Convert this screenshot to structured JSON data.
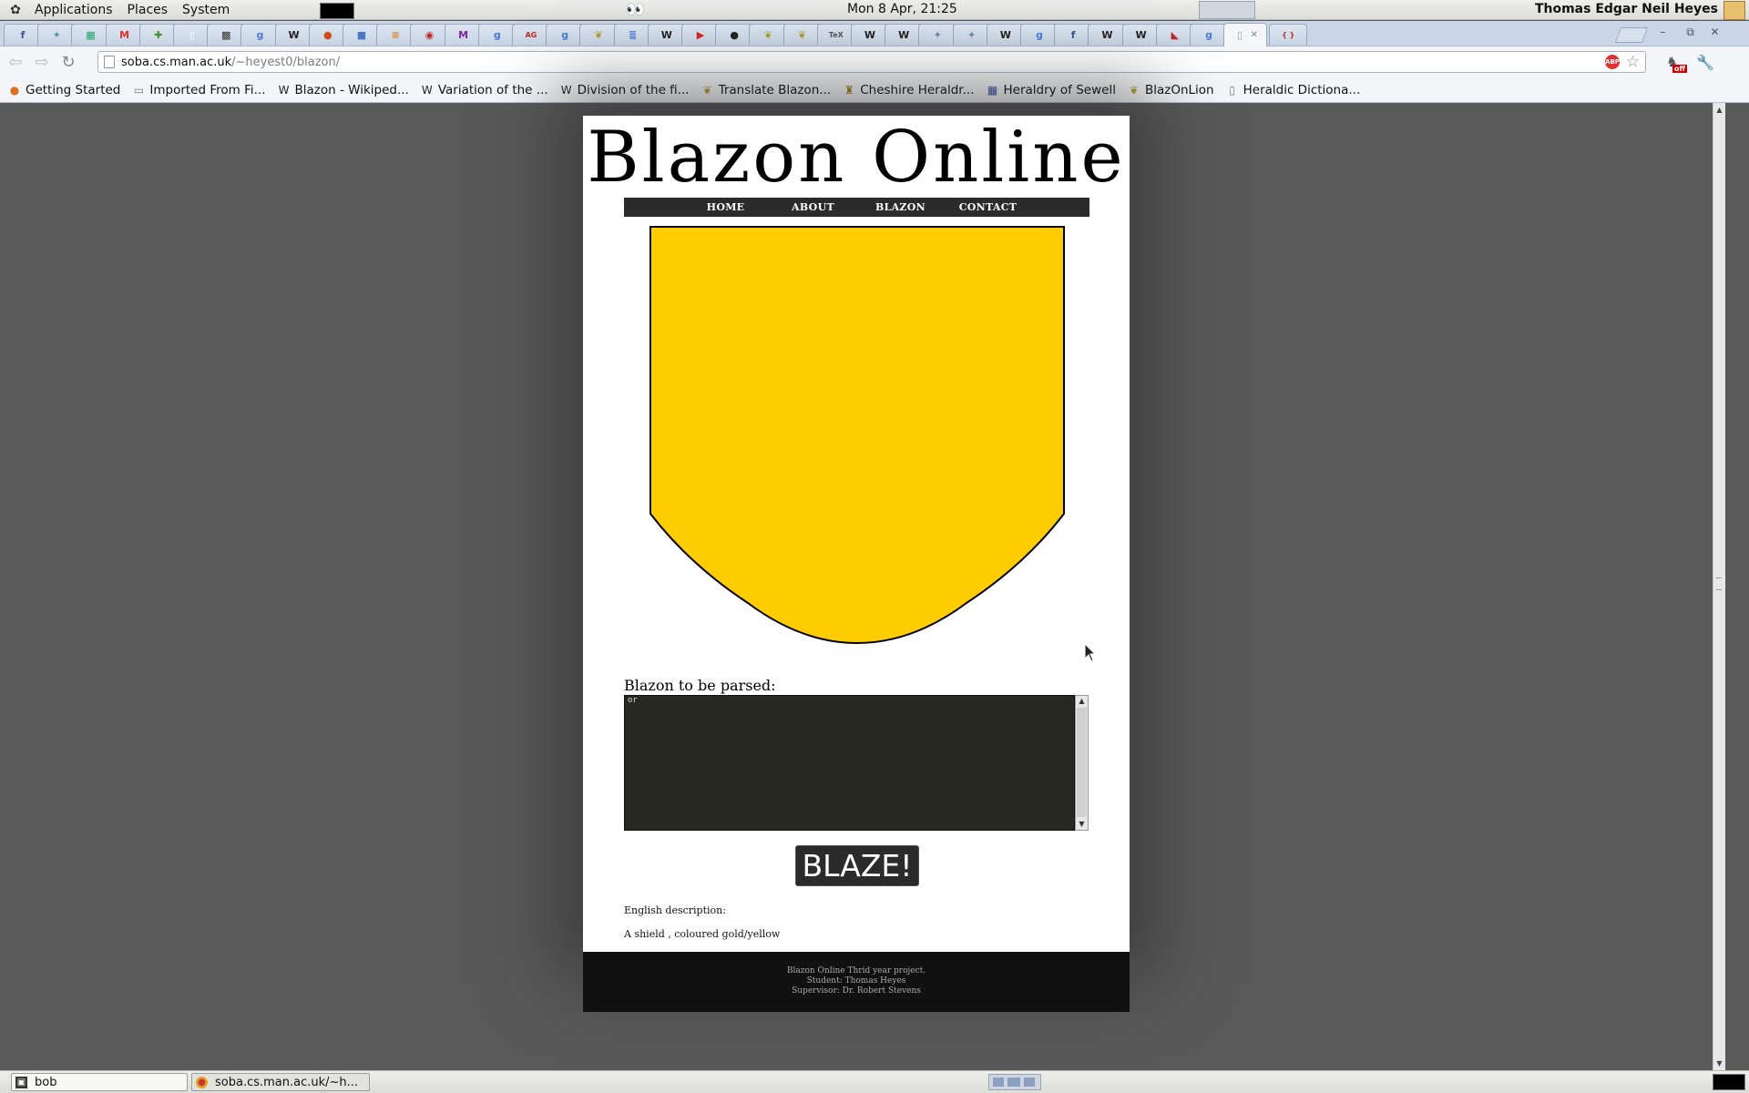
{
  "top_panel": {
    "menus": [
      "Applications",
      "Places",
      "System"
    ],
    "clock": "Mon  8 Apr, 21:25",
    "user": "Thomas Edgar Neil Heyes",
    "eyes": "👀"
  },
  "tabs": [
    {
      "icon": "facebook-icon",
      "glyph": "f",
      "color": "#3b5998"
    },
    {
      "icon": "blazon-icon",
      "glyph": "✦",
      "color": "#5a8fb0"
    },
    {
      "icon": "spreadsheet-icon",
      "glyph": "▦",
      "color": "#1fa463"
    },
    {
      "icon": "gmail-icon",
      "glyph": "M",
      "color": "#d33"
    },
    {
      "icon": "google-icon",
      "glyph": "✚",
      "color": "#4b8f29"
    },
    {
      "icon": "document-icon",
      "glyph": "▯",
      "color": "#ffffff"
    },
    {
      "icon": "qr-icon",
      "glyph": "▩",
      "color": "#333333"
    },
    {
      "icon": "google-icon",
      "glyph": "g",
      "color": "#4a7bd8"
    },
    {
      "icon": "wikipedia-icon",
      "glyph": "W",
      "color": "#222222"
    },
    {
      "icon": "orange-app-icon",
      "glyph": "●",
      "color": "#d04a1a"
    },
    {
      "icon": "blue-square-icon",
      "glyph": "■",
      "color": "#4a78c4"
    },
    {
      "icon": "stack-icon",
      "glyph": "≡",
      "color": "#e07b20"
    },
    {
      "icon": "red-circle-icon",
      "glyph": "◉",
      "color": "#c02828"
    },
    {
      "icon": "m-icon",
      "glyph": "M",
      "color": "#7a2a9a"
    },
    {
      "icon": "google-icon",
      "glyph": "g",
      "color": "#4a7bd8"
    },
    {
      "icon": "ag-icon",
      "glyph": "AG",
      "color": "#c02828"
    },
    {
      "icon": "google-icon",
      "glyph": "g",
      "color": "#4a7bd8"
    },
    {
      "icon": "lion-icon",
      "glyph": "❦",
      "color": "#b09a30"
    },
    {
      "icon": "docs-icon",
      "glyph": "≣",
      "color": "#3d6fd8"
    },
    {
      "icon": "wikipedia-icon",
      "glyph": "W",
      "color": "#222222"
    },
    {
      "icon": "youtube-icon",
      "glyph": "▶",
      "color": "#d22"
    },
    {
      "icon": "github-icon",
      "glyph": "●",
      "color": "#222222"
    },
    {
      "icon": "lion-icon",
      "glyph": "❦",
      "color": "#b09a30"
    },
    {
      "icon": "lion-icon",
      "glyph": "❦",
      "color": "#b09a30"
    },
    {
      "icon": "tex-icon",
      "glyph": "TeX",
      "color": "#555555"
    },
    {
      "icon": "wikipedia-icon",
      "glyph": "W",
      "color": "#222222"
    },
    {
      "icon": "wikipedia-icon",
      "glyph": "W",
      "color": "#222222"
    },
    {
      "icon": "blazon-icon",
      "glyph": "✦",
      "color": "#5a8fb0"
    },
    {
      "icon": "blazon-icon",
      "glyph": "✦",
      "color": "#5a8fb0"
    },
    {
      "icon": "wikipedia-icon",
      "glyph": "W",
      "color": "#222222"
    },
    {
      "icon": "google-icon",
      "glyph": "g",
      "color": "#4a7bd8"
    },
    {
      "icon": "facebook-icon",
      "glyph": "f",
      "color": "#3b5998"
    },
    {
      "icon": "wikipedia-icon",
      "glyph": "W",
      "color": "#222222"
    },
    {
      "icon": "wikipedia-icon",
      "glyph": "W",
      "color": "#222222"
    },
    {
      "icon": "flag-icon",
      "glyph": "◣",
      "color": "#c02828"
    },
    {
      "icon": "google-icon",
      "glyph": "g",
      "color": "#4a7bd8"
    },
    {
      "icon": "page-icon",
      "glyph": "▯",
      "color": "#999999",
      "active": true
    },
    {
      "icon": "bracket-icon",
      "glyph": "{ }",
      "color": "#c02828"
    }
  ],
  "omnibox": {
    "host": "soba.cs.man.ac.uk",
    "path": "/~heyest0/blazon/",
    "abp": "ABP",
    "ext_off": "off"
  },
  "bookmarks": [
    {
      "label": "Getting Started",
      "icon": "firefox-icon",
      "glyph": "●",
      "color": "#d9701f"
    },
    {
      "label": "Imported From Fi...",
      "icon": "folder-icon",
      "glyph": "▭",
      "color": "#777777"
    },
    {
      "label": "Blazon - Wikiped...",
      "icon": "wikipedia-icon",
      "glyph": "W",
      "color": "#222222"
    },
    {
      "label": "Variation of the ...",
      "icon": "wikipedia-icon",
      "glyph": "W",
      "color": "#222222"
    },
    {
      "label": "Division of the fi...",
      "icon": "wikipedia-icon",
      "glyph": "W",
      "color": "#222222"
    },
    {
      "label": "Translate Blazon...",
      "icon": "lion-icon",
      "glyph": "❦",
      "color": "#b09a30"
    },
    {
      "label": "Cheshire Heraldr...",
      "icon": "heraldry-icon",
      "glyph": "♜",
      "color": "#a07a20"
    },
    {
      "label": "Heraldry of Sewell",
      "icon": "calendar-icon",
      "glyph": "▦",
      "color": "#3050a0"
    },
    {
      "label": "BlazOnLion",
      "icon": "lion-icon",
      "glyph": "❦",
      "color": "#b09a30"
    },
    {
      "label": "Heraldic Dictiona...",
      "icon": "page-icon",
      "glyph": "▯",
      "color": "#777777"
    }
  ],
  "site": {
    "title": "Blazon Online",
    "nav": [
      "HOME",
      "ABOUT",
      "BLAZON",
      "CONTACT"
    ],
    "shield_tincture": "#ffcc00",
    "blazon_label": "Blazon to be parsed:",
    "blazon_value": "or",
    "blaze_button": "BLAZE!",
    "english_label": "English description:",
    "english_value": "A shield , coloured gold/yellow",
    "footer": [
      "Blazon Online Thrid year project.",
      "Student: Thomas Heyes",
      "Supervisor: Dr. Robert Stevens"
    ]
  },
  "taskbar": {
    "items": [
      {
        "label": "bob",
        "icon": "terminal-icon"
      },
      {
        "label": "soba.cs.man.ac.uk/~h...",
        "icon": "chrome-icon"
      }
    ]
  }
}
